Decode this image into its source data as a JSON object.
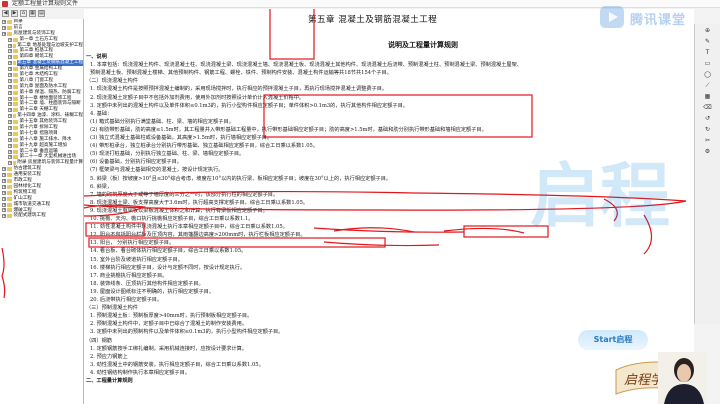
{
  "window": {
    "title": "定额工程量计算规则文件"
  },
  "toolbar": {
    "buttons": [
      "◀",
      "▶",
      "⌂",
      "▦",
      "▤"
    ]
  },
  "sidebar": {
    "items": [
      {
        "label": "目录",
        "level": 0,
        "sel": false
      },
      {
        "label": "前言",
        "level": 0,
        "sel": false
      },
      {
        "label": "房屋建筑与装饰工程",
        "level": 0,
        "sel": false
      },
      {
        "label": "第一章  土石方工程",
        "level": 1,
        "sel": false
      },
      {
        "label": "第二章  地基处理与边坡支护工程",
        "level": 1,
        "sel": false
      },
      {
        "label": "第三章  桩基工程",
        "level": 1,
        "sel": false
      },
      {
        "label": "第四章  砌筑工程",
        "level": 1,
        "sel": false
      },
      {
        "label": "第五章  混凝土及钢筋混凝土工程",
        "level": 1,
        "sel": true
      },
      {
        "label": "第六章  金属结构工程",
        "level": 1,
        "sel": false
      },
      {
        "label": "第七章  木结构工程",
        "level": 1,
        "sel": false
      },
      {
        "label": "第八章  门窗工程",
        "level": 1,
        "sel": false
      },
      {
        "label": "第九章  屋面及防水工程",
        "level": 1,
        "sel": false
      },
      {
        "label": "第十章  保温、隔热、防腐工程",
        "level": 1,
        "sel": false
      },
      {
        "label": "第十一章  楼地面装饰工程",
        "level": 1,
        "sel": false
      },
      {
        "label": "第十二章  墙、柱面装饰与隔断",
        "level": 1,
        "sel": false
      },
      {
        "label": "第十三章  天棚工程",
        "level": 1,
        "sel": false
      },
      {
        "label": "第十四章  油漆、涂料、裱糊工程",
        "level": 1,
        "sel": false
      },
      {
        "label": "第十五章  其他装饰工程",
        "level": 1,
        "sel": false
      },
      {
        "label": "第十六章  拆除工程",
        "level": 1,
        "sel": false
      },
      {
        "label": "第十七章  措施项目",
        "level": 1,
        "sel": false
      },
      {
        "label": "第十八章  施工排水、降水",
        "level": 1,
        "sel": false
      },
      {
        "label": "第十九章  超高施工增加",
        "level": 1,
        "sel": false
      },
      {
        "label": "第二十章  垂直运输",
        "level": 1,
        "sel": false
      },
      {
        "label": "第二十一章  大型机械进出场",
        "level": 1,
        "sel": false
      },
      {
        "label": "附录  房屋建筑与装饰工程量计算",
        "level": 1,
        "sel": false
      },
      {
        "label": "仿古建筑工程",
        "level": 0,
        "sel": false
      },
      {
        "label": "通用安装工程",
        "level": 0,
        "sel": false
      },
      {
        "label": "市政工程",
        "level": 0,
        "sel": false
      },
      {
        "label": "园林绿化工程",
        "level": 0,
        "sel": false
      },
      {
        "label": "构筑物工程",
        "level": 0,
        "sel": false
      },
      {
        "label": "矿山工程",
        "level": 0,
        "sel": false
      },
      {
        "label": "城市轨道交通工程",
        "level": 0,
        "sel": false
      },
      {
        "label": "爆破工程",
        "level": 0,
        "sel": false
      },
      {
        "label": "装配式建筑工程",
        "level": 0,
        "sel": false
      }
    ]
  },
  "doc": {
    "title": "第五章  混凝土及钢筋混凝土工程",
    "subtitle": "说明及工程量计算规则",
    "lines": [
      "一、说明",
      "1. 本章包括：现浇混凝土构件、现浇混凝土柱、现浇混凝土梁、现浇混凝土墙、现浇混凝土板、现浇混凝土其他构件、现浇混凝土后浇带、预制混凝土柱、预制混凝土梁、预制混凝土屋架、",
      "预制混凝土板、预制混凝土楼梯、其他预制构件、钢筋工程、螺栓、铁件、预制构件安装、混凝土构件运输等共18节共154个子目。",
      "（二）现浇混凝土构件",
      "1. 现浇混凝土构件是按照预拌混凝土编制的，采用现场搅拌时，执行相应的预拌混凝土子目，再执行现场搅拌混凝土调整费子目。",
      "2. 现浇混凝土定额子目中不包括外加剂费用，使用外加剂时按照设计单价计入混凝土价格中。",
      "3. 定额中未列出的混凝土构件以及单件体积≤0.1m3的，执行小型构件相应定额子目；单件体积>0.1m3的，执行其他构件相应定额子目。",
      "4. 基础：",
      "(1) 箱式基础分别执行满堂基础、柱、梁、墙的相应定额子目。",
      "(2) 有肋带形基础，肋的高度≤1.5m时，其工程量并入带形基础工程量中，执行带形基础相应定额子目；肋的高度>1.5m时，基础和肋分别执行带形基础和墙相应定额子目。",
      "(3) 独立式混凝土基础柱或设备基础，其高度>1.5m时，执行墙相应定额子目。",
      "(4) 带形桩承台，独立桩承台分别执行带形基础、独立基础相应定额子目，综合工日乘以系数1.05。",
      "(5) 现浇打桩基础，分别执行独立基础、柱、梁、墙相应定额子目。",
      "(6) 设备基础，分别执行相应定额子目。",
      "(7) 框架梁与混凝土基础相交的混凝土，按设计规定执行。",
      "5. 斜梁（板）按坡度>10°且≤30°综合考虑，坡度在10°以内的执行梁、板相应定额子目；坡度在30°以上的，执行相应定额子目。",
      "6. 斜梁，",
      "7. 墙的砌筑厚度大于或等于墙厚度的三分之一时，该部分执行柱的相应定额子目。",
      "8. 现浇混凝土梁、板支撑高度大于3.6m时，执行超高支撑定额子目，综合工日乘以系数1.05。",
      "9. 现浇混凝土有梁板以梁板混凝土体积之和计算，执行有梁板相应定额子目。",
      "10. 挑檐、天沟、檐口执行挑檐相应定额子目，综合工日乘以系数1.1。",
      "11. 劲性混凝土构件中现浇混凝土执行本章相应定额子目中，综合工日乘以系数1.05。",
      "12. 阳台不包括阳台栏板及压顶内容，其雨篷翻边高度>200mm时，执行栏板相应定额子目。",
      "13. 阳台，                       分别执行相应定额子目。",
      "14. 看台板、看台砌体执行相应定额子目，综合工日乘以系数1.05。",
      "15. 室外台阶及坡道执行相应定额子目。",
      "16. 楼梯执行相应定额子目，设计与定额不同时，按设计规定执行。",
      "17. 商业挑檐执行相应定额子目。",
      "18. 装饰线条、压顶执行其他构件相应定额子目。",
      "19. 屋面设计图纸标注不明确的，执行相应定额子目。",
      "20. 后浇带执行相应定额子目。",
      "（三）预制混凝土构件",
      "1. 预制混凝土板：预制板厚度>40mm时，执行预制板相应定额子目。",
      "2. 预制混凝土构件中，定额子目中已综合了混凝土的制作安装费用。",
      "3. 定额中未列出的预制构件以及单件体积≤0.1m3的，执行小型构件相应定额子目。",
      "（四）钢筋",
      "1. 定额钢筋按手工绑扎编制，采用机械连接时，应按设计要求计算。",
      "2. 预应力钢筋上",
      "3. 劲性混凝土中的钢筋安装，执行相应定额子目，综合工日乘以系数1.05。",
      "4. 劲性钢结构制作执行本章相应定额子目。",
      "二、工程量计算规则"
    ]
  },
  "rtool": {
    "items": [
      "⊕",
      "✎",
      "T",
      "▭",
      "◯",
      "⟋",
      "▦",
      "⌫",
      "↺",
      "↻",
      "✂",
      "⚙"
    ]
  },
  "watermark": {
    "text": "腾讯课堂"
  },
  "bg_logo": {
    "text": "启程"
  },
  "badge": {
    "text": "Start启程"
  },
  "banner": {
    "text": "启程学院"
  },
  "colors": {
    "annotation": "#e3161b",
    "selection": "#3a70c8",
    "watermark": "#78aae6"
  }
}
